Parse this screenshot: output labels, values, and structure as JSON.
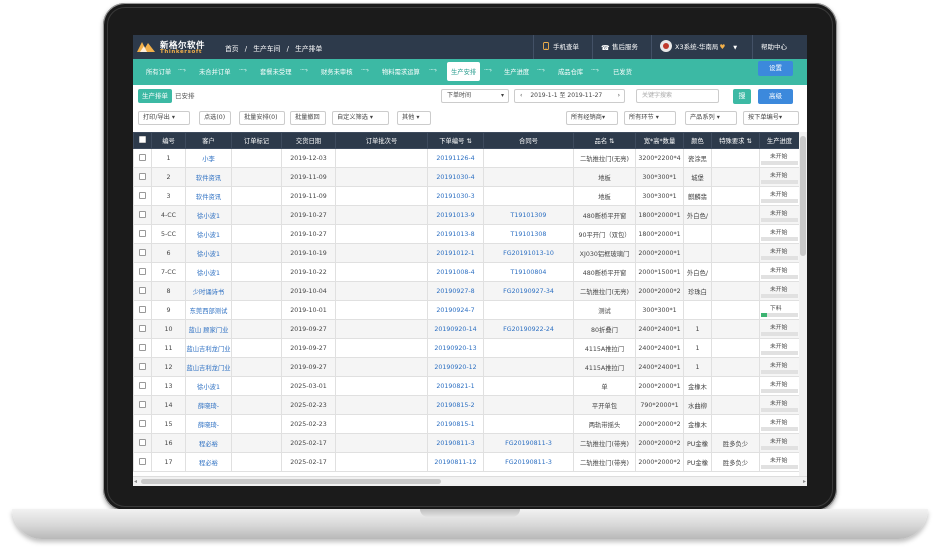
{
  "header": {
    "logo_cn": "新格尔软件",
    "logo_en": "Thinkersoft",
    "breadcrumb": [
      "首页",
      "/",
      "生产车间",
      "/",
      "生产排单"
    ],
    "mobile_order": "手机查单",
    "after_sales": "售后服务",
    "user": "X3系统-华南局",
    "help": "帮助中心"
  },
  "flow": {
    "steps": [
      "所有订单",
      "未合并订单",
      "套餐未受理",
      "财务未审核",
      "物料需求运算",
      "生产安排",
      "生产进度",
      "成品仓库",
      "已发货"
    ],
    "active_index": 5,
    "settings": "设置"
  },
  "subbar": {
    "tab_on": "生产排单",
    "tab_off": "已安排",
    "time_field": "下单时间",
    "date_range": "2019-1-1 至 2019-11-27",
    "search_placeholder": "关键字搜索",
    "search_btn": "搜",
    "advanced": "高级"
  },
  "toolbar": {
    "print": "打印/导出",
    "picked": "点选(0)",
    "batch_arrange": "批量安排(0)",
    "batch_return": "批量撤回",
    "custom_filter": "自定义筛选",
    "other": "其他",
    "dealer": "所有经销商",
    "stage": "所有环节",
    "product_series": "产品系列",
    "sort": "按下单编号"
  },
  "table": {
    "headers": [
      "编号",
      "客户",
      "订单标记",
      "交货日期",
      "订单批次号",
      "下单编号",
      "合同号",
      "品名",
      "宽*高*数量",
      "颜色",
      "特殊要求",
      "生产进度"
    ],
    "rows": [
      {
        "no": "1",
        "customer": "小李",
        "mark": "",
        "date": "2019-12-03",
        "batch": "",
        "order": "20191126-4",
        "contract": "",
        "name": "二轨推拉门(无亮)",
        "size": "3200*2200*4",
        "color": "瓷涂黑",
        "special": "",
        "progress": "未开始",
        "pct": 0
      },
      {
        "no": "2",
        "customer": "软件资讯",
        "mark": "",
        "date": "2019-11-09",
        "batch": "",
        "order": "20191030-4",
        "contract": "",
        "name": "地板",
        "size": "300*300*1",
        "color": "城堡",
        "special": "",
        "progress": "未开始",
        "pct": 0
      },
      {
        "no": "3",
        "customer": "软件资讯",
        "mark": "",
        "date": "2019-11-09",
        "batch": "",
        "order": "20191030-3",
        "contract": "",
        "name": "地板",
        "size": "300*300*1",
        "color": "麒麟翡",
        "special": "",
        "progress": "未开始",
        "pct": 0
      },
      {
        "no": "4-CC",
        "customer": "徐小波1",
        "mark": "",
        "date": "2019-10-27",
        "batch": "",
        "order": "20191013-9",
        "contract": "T19101309",
        "name": "480断桥平开窗",
        "size": "1800*2000*1",
        "color": "外白色/",
        "special": "",
        "progress": "未开始",
        "pct": 0
      },
      {
        "no": "5-CC",
        "customer": "徐小波1",
        "mark": "",
        "date": "2019-10-27",
        "batch": "",
        "order": "20191013-8",
        "contract": "T19101308",
        "name": "90平开门（双包）",
        "size": "1800*2000*1",
        "color": "",
        "special": "",
        "progress": "未开始",
        "pct": 0
      },
      {
        "no": "6",
        "customer": "徐小波1",
        "mark": "",
        "date": "2019-10-19",
        "batch": "",
        "order": "20191012-1",
        "contract": "FG20191013-10",
        "name": "XJ030铝框玻璃门",
        "size": "2000*2000*1",
        "color": "",
        "special": "",
        "progress": "未开始",
        "pct": 0
      },
      {
        "no": "7-CC",
        "customer": "徐小波1",
        "mark": "",
        "date": "2019-10-22",
        "batch": "",
        "order": "20191008-4",
        "contract": "T19100804",
        "name": "480断桥平开窗",
        "size": "2000*1500*1",
        "color": "外白色/",
        "special": "",
        "progress": "未开始",
        "pct": 0
      },
      {
        "no": "8",
        "customer": "少时诵诗书",
        "mark": "",
        "date": "2019-10-04",
        "batch": "",
        "order": "20190927-8",
        "contract": "FG20190927-34",
        "name": "二轨推拉门(无亮)",
        "size": "2000*2000*2",
        "color": "珍珠白",
        "special": "",
        "progress": "未开始",
        "pct": 0
      },
      {
        "no": "9",
        "customer": "东莞西部测试",
        "mark": "",
        "date": "2019-10-01",
        "batch": "",
        "order": "20190924-7",
        "contract": "",
        "name": "测试",
        "size": "300*300*1",
        "color": "",
        "special": "",
        "progress": "下料",
        "pct": 15
      },
      {
        "no": "10",
        "customer": "蓝山 顾家门业",
        "mark": "",
        "date": "2019-09-27",
        "batch": "",
        "order": "20190920-14",
        "contract": "FG20190922-24",
        "name": "80折叠门",
        "size": "2400*2400*1",
        "color": "1",
        "special": "",
        "progress": "未开始",
        "pct": 0
      },
      {
        "no": "11",
        "customer": "蓝山吉利龙门业",
        "mark": "",
        "date": "2019-09-27",
        "batch": "",
        "order": "20190920-13",
        "contract": "",
        "name": "4115A推拉门",
        "size": "2400*2400*1",
        "color": "1",
        "special": "",
        "progress": "未开始",
        "pct": 0
      },
      {
        "no": "12",
        "customer": "蓝山吉利龙门业",
        "mark": "",
        "date": "2019-09-27",
        "batch": "",
        "order": "20190920-12",
        "contract": "",
        "name": "4115A推拉门",
        "size": "2400*2400*1",
        "color": "1",
        "special": "",
        "progress": "未开始",
        "pct": 0
      },
      {
        "no": "13",
        "customer": "徐小波1",
        "mark": "",
        "date": "2025-03-01",
        "batch": "",
        "order": "20190821-1",
        "contract": "",
        "name": "单",
        "size": "2000*2000*1",
        "color": "金橡木",
        "special": "",
        "progress": "未开始",
        "pct": 0
      },
      {
        "no": "14",
        "customer": "薛晓琦-",
        "mark": "",
        "date": "2025-02-23",
        "batch": "",
        "order": "20190815-2",
        "contract": "",
        "name": "平开单包",
        "size": "790*2000*1",
        "color": "水曲柳",
        "special": "",
        "progress": "未开始",
        "pct": 0
      },
      {
        "no": "15",
        "customer": "薛晓琦-",
        "mark": "",
        "date": "2025-02-23",
        "batch": "",
        "order": "20190815-1",
        "contract": "",
        "name": "两轨带摇头",
        "size": "2000*2000*2",
        "color": "金橡木",
        "special": "",
        "progress": "未开始",
        "pct": 0
      },
      {
        "no": "16",
        "customer": "程必裕",
        "mark": "",
        "date": "2025-02-17",
        "batch": "",
        "order": "20190811-3",
        "contract": "FG20190811-3",
        "name": "二轨推拉门(带亮)",
        "size": "2000*2000*2",
        "color": "PU金橡",
        "special": "胜多负少",
        "progress": "未开始",
        "pct": 0
      },
      {
        "no": "17",
        "customer": "程必裕",
        "mark": "",
        "date": "2025-02-17",
        "batch": "",
        "order": "20190811-12",
        "contract": "FG20190811-3",
        "name": "二轨推拉门(带亮)",
        "size": "2000*2000*2",
        "color": "PU金橡",
        "special": "胜多负少",
        "progress": "未开始",
        "pct": 0
      }
    ]
  },
  "colors": {
    "topbar": "#2d3a4b",
    "flowbar": "#3cb9a4",
    "accent_blue": "#3c89dc",
    "link": "#2c6fc2",
    "progress": "#3cb371"
  }
}
